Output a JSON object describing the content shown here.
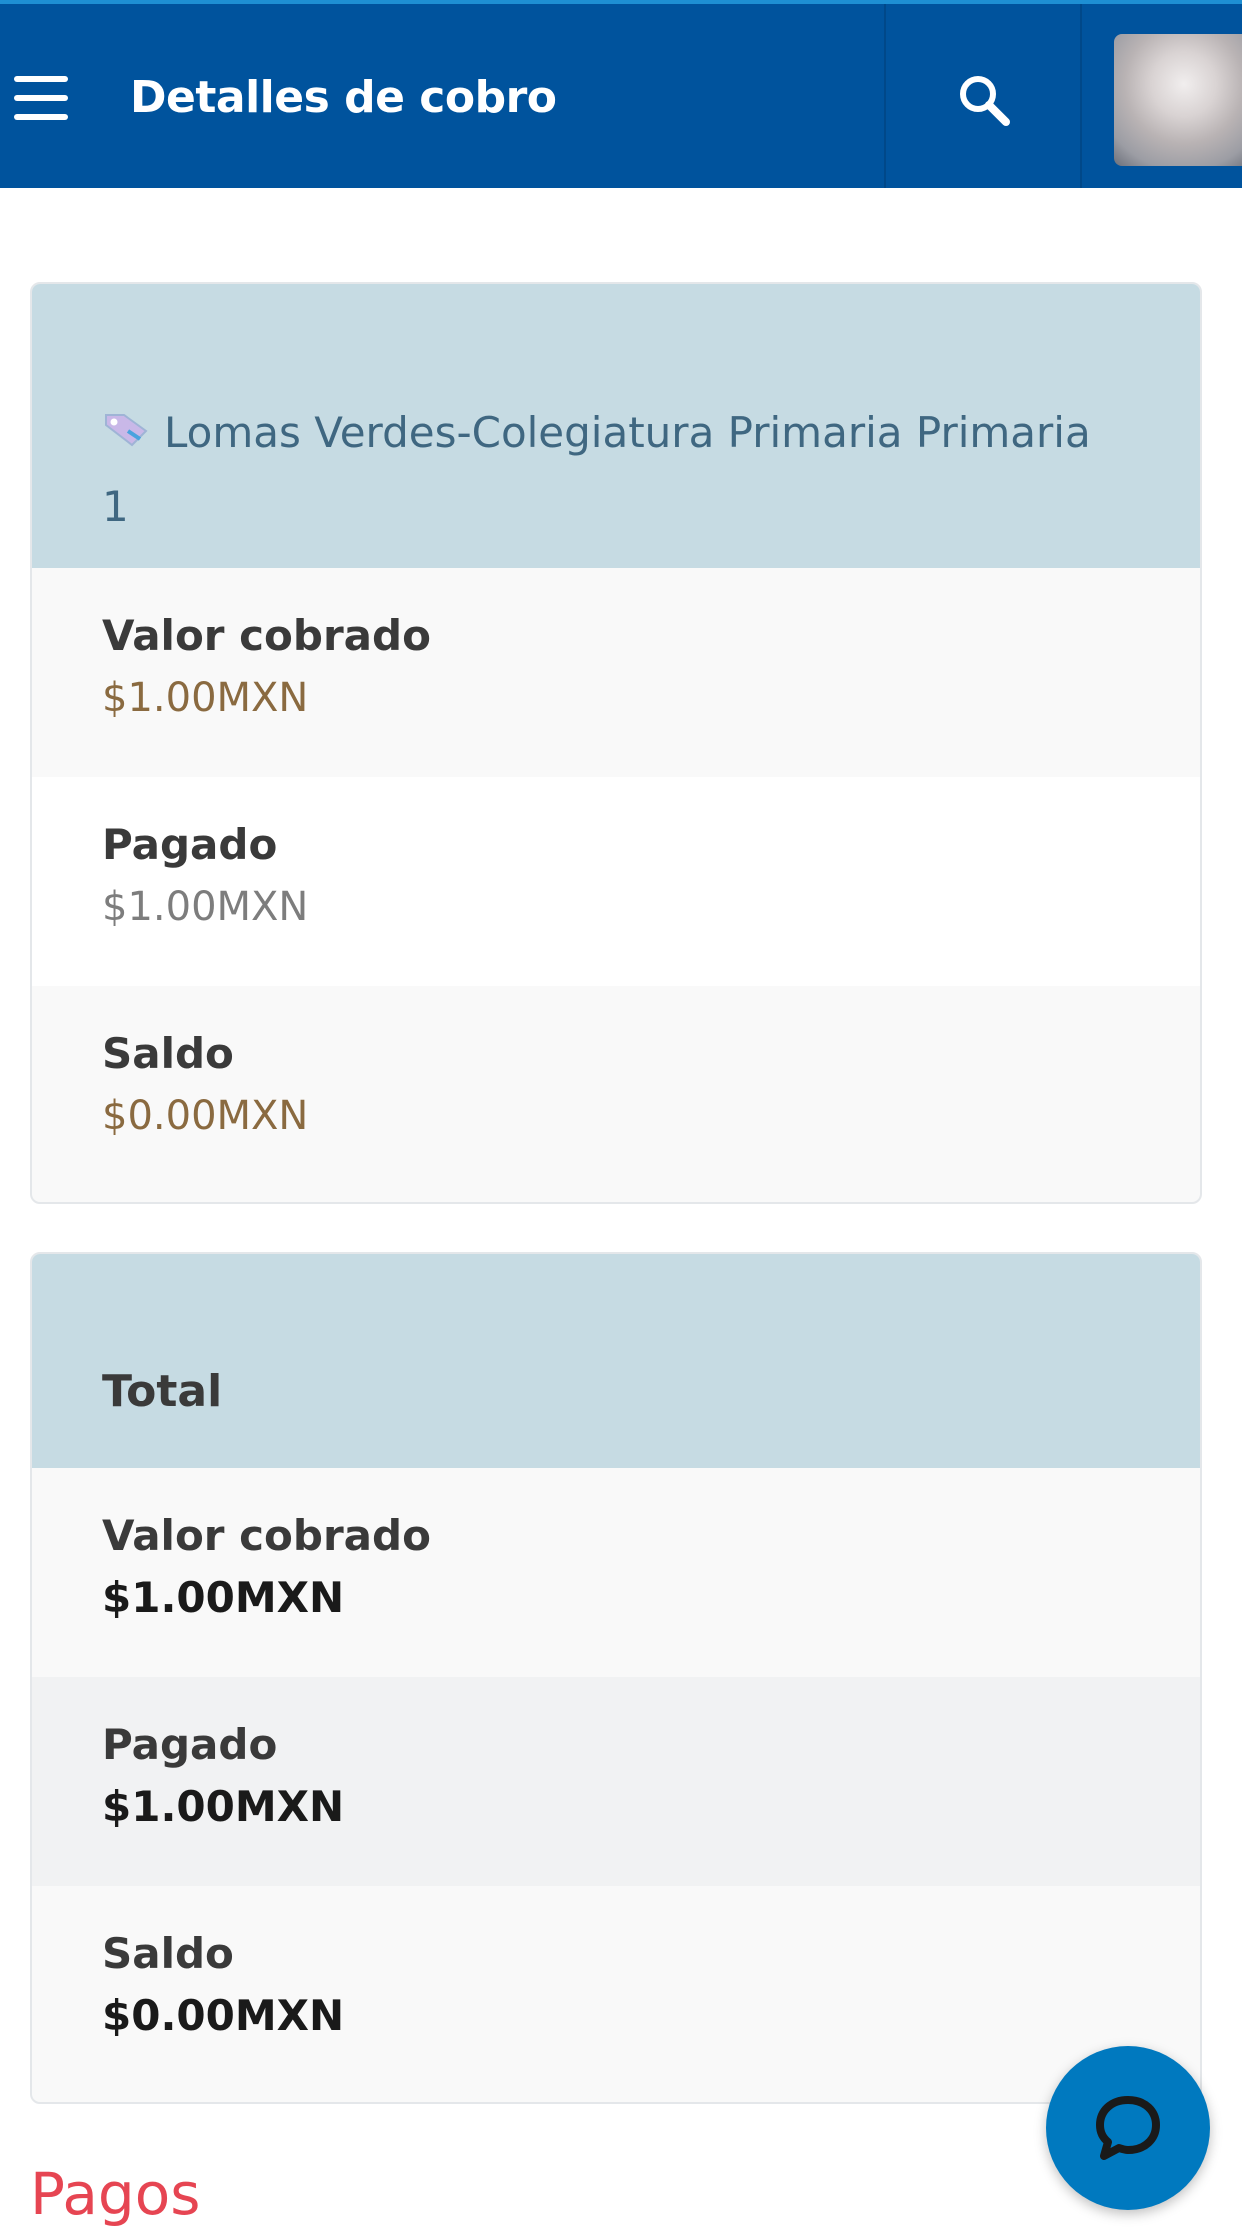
{
  "appbar": {
    "title": "Detalles de cobro",
    "menu_icon": "hamburger-icon",
    "search_icon": "search-icon",
    "avatar": "user-avatar"
  },
  "charge_card": {
    "concept_icon": "tag-icon",
    "concept": "Lomas Verdes-Colegiatura Primaria Primaria 1",
    "rows": [
      {
        "label": "Valor cobrado",
        "value": "$1.00MXN"
      },
      {
        "label": "Pagado",
        "value": "$1.00MXN"
      },
      {
        "label": "Saldo",
        "value": "$0.00MXN"
      }
    ]
  },
  "total_card": {
    "title": "Total",
    "rows": [
      {
        "label": "Valor cobrado",
        "value": "$1.00MXN"
      },
      {
        "label": "Pagado",
        "value": "$1.00MXN"
      },
      {
        "label": "Saldo",
        "value": "$0.00MXN"
      }
    ]
  },
  "payments": {
    "heading": "Pagos"
  },
  "chat": {
    "icon": "chat-bubble-icon"
  },
  "colors": {
    "appbar": "#00539d",
    "card_header": "#c6dbe3",
    "pagos_heading": "#e64552",
    "fab": "#0079bf"
  }
}
